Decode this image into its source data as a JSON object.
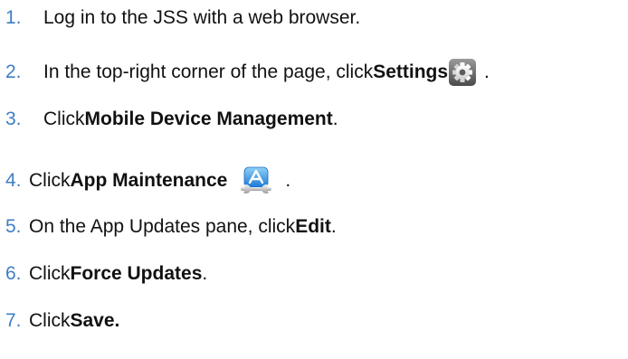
{
  "steps": [
    {
      "num": "1.",
      "text": "Log in to the JSS with a web browser."
    },
    {
      "num": "2.",
      "pre": "In the top-right corner of the page, click ",
      "bold": "Settings",
      "icon": "gear-icon",
      "post": "."
    },
    {
      "num": "3.",
      "pre": "Click ",
      "bold": "Mobile Device Management",
      "post": "."
    },
    {
      "num": "4.",
      "pre": "Click ",
      "bold": "App Maintenance",
      "icon": "app-store-wrench-icon",
      "post": "."
    },
    {
      "num": "5.",
      "pre": "On the App Updates pane, click ",
      "bold": "Edit",
      "post": "."
    },
    {
      "num": "6.",
      "pre": "Click ",
      "bold": "Force Updates",
      "post": "."
    },
    {
      "num": "7.",
      "pre": "Click ",
      "bold": "Save."
    }
  ],
  "colors": {
    "step_number": "#3d7fc4",
    "text": "#111111"
  }
}
